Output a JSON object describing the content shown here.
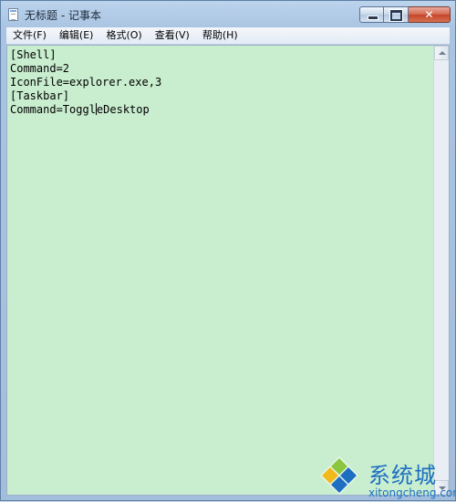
{
  "window": {
    "title": "无标题 - 记事本",
    "close_glyph": "✕"
  },
  "menu": [
    {
      "label": "文件(F)"
    },
    {
      "label": "编辑(E)"
    },
    {
      "label": "格式(O)"
    },
    {
      "label": "查看(V)"
    },
    {
      "label": "帮助(H)"
    }
  ],
  "editor": {
    "lines": [
      "[Shell]",
      "Command=2",
      "IconFile=explorer.exe,3",
      "[Taskbar]"
    ],
    "last_line_before_caret": "Command=Toggl",
    "last_line_after_caret": "eDesktop",
    "background_color": "#c9edcf"
  },
  "watermark": {
    "name": "系统城",
    "url": "xitongcheng.com"
  },
  "icons": {
    "app": "notepad-icon",
    "minimize": "minimize-icon",
    "maximize": "maximize-icon",
    "close": "close-icon",
    "scroll_up": "scroll-up-arrow-icon",
    "scroll_down": "scroll-down-arrow-icon",
    "watermark_logo": "diamond-logo-icon"
  }
}
